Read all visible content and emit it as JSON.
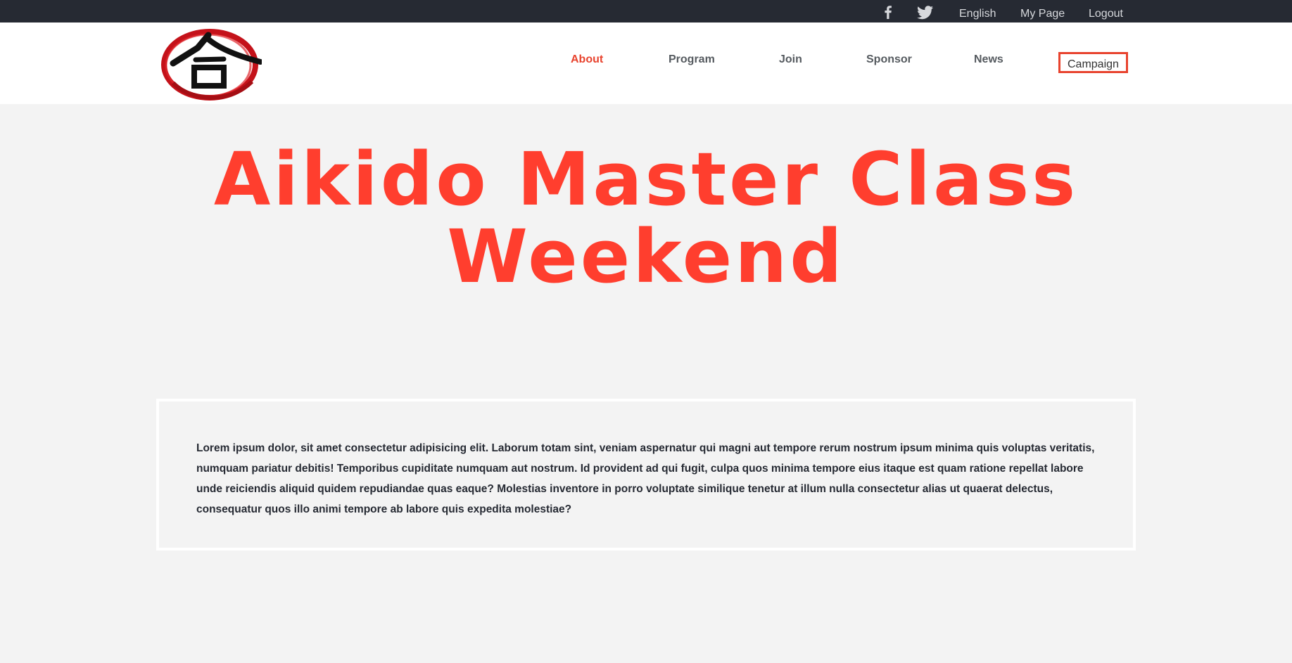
{
  "topbar": {
    "icons": [
      "facebook-icon",
      "twitter-icon"
    ],
    "language": "English",
    "my_page": "My Page",
    "logout": "Logout"
  },
  "header": {
    "logo_icon": "aikido-kanji-logo",
    "nav": [
      {
        "label": "About",
        "state": "active"
      },
      {
        "label": "Program"
      },
      {
        "label": "Join"
      },
      {
        "label": "Sponsor"
      },
      {
        "label": "News"
      },
      {
        "label": "Campaign",
        "state": "boxed"
      }
    ]
  },
  "hero": {
    "line1": "Aikido Master Class",
    "line2": "Weekend"
  },
  "content": {
    "paragraph": "Lorem ipsum dolor, sit amet consectetur adipisicing elit. Laborum totam sint, veniam aspernatur qui magni aut tempore rerum nostrum ipsum minima quis voluptas veritatis, numquam pariatur debitis! Temporibus cupiditate numquam aut nostrum. Id provident ad qui fugit, culpa quos minima tempore eius itaque est quam ratione repellat labore unde reiciendis aliquid quidem repudiandae quas eaque? Molestias inventore in porro voluptate similique tenetur at illum nulla consectetur alias ut quaerat delectus, consequatur quos illo animi tempore ab labore quis expedita molestiae?"
  },
  "colors": {
    "accent": "#ff3e2e",
    "topbar_bg": "#262a33",
    "page_bg": "#f3f3f3"
  }
}
